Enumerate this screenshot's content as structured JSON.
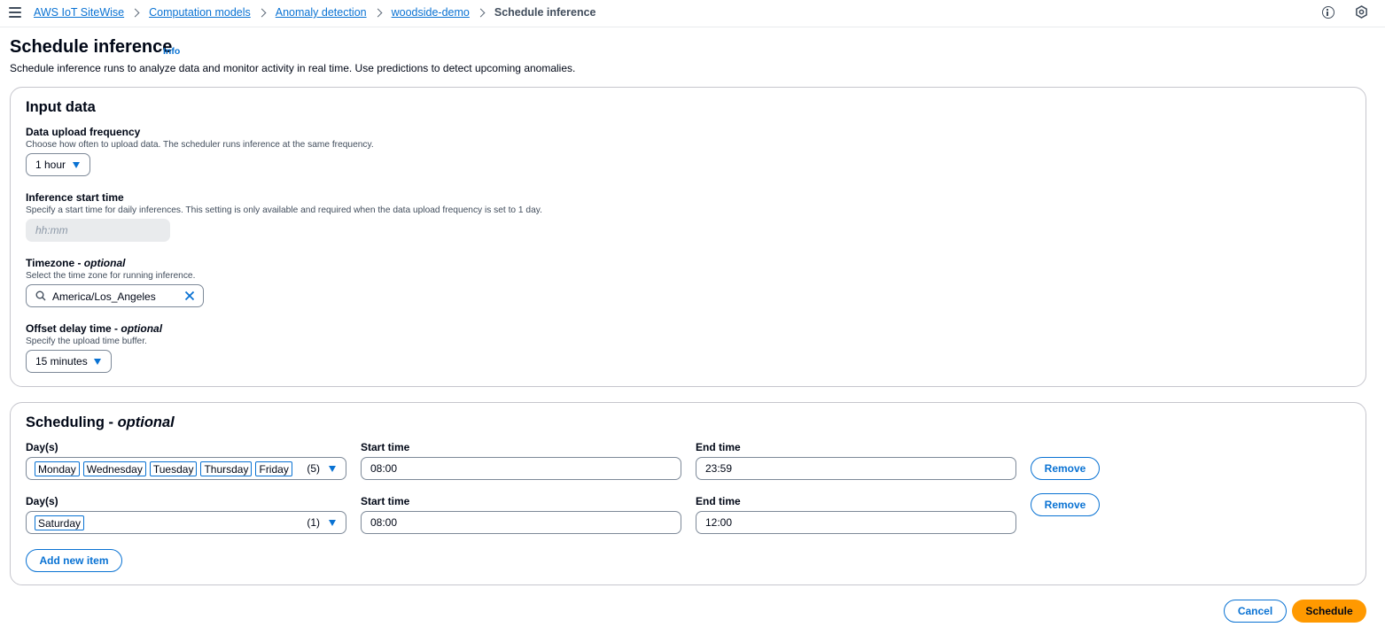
{
  "breadcrumbs": {
    "items": [
      "AWS IoT SiteWise",
      "Computation models",
      "Anomaly detection",
      "woodside-demo"
    ],
    "current": "Schedule inference"
  },
  "header": {
    "title": "Schedule inference",
    "info_link": "Info",
    "description": "Schedule inference runs to analyze data and monitor activity in real time. Use predictions to detect upcoming anomalies."
  },
  "input_data": {
    "title": "Input data",
    "upload_frequency": {
      "label": "Data upload frequency",
      "description": "Choose how often to upload data. The scheduler runs inference at the same frequency.",
      "value": "1 hour"
    },
    "start_time": {
      "label": "Inference start time",
      "description": "Specify a start time for daily inferences. This setting is only available and required when the data upload frequency is set to 1 day.",
      "placeholder": "hh:mm"
    },
    "timezone": {
      "label": "Timezone",
      "optional": "optional",
      "description": "Select the time zone for running inference.",
      "value": "America/Los_Angeles"
    },
    "offset_delay": {
      "label": "Offset delay time",
      "optional": "optional",
      "description": "Specify the upload time buffer.",
      "value": "15 minutes"
    }
  },
  "scheduling": {
    "title": "Scheduling",
    "optional": "optional",
    "days_label": "Day(s)",
    "start_label": "Start time",
    "end_label": "End time",
    "remove_label": "Remove",
    "add_label": "Add new item",
    "rows": [
      {
        "days": [
          "Monday",
          "Wednesday",
          "Tuesday",
          "Thursday",
          "Friday"
        ],
        "count": "(5)",
        "start": "08:00",
        "end": "23:59"
      },
      {
        "days": [
          "Saturday"
        ],
        "count": "(1)",
        "start": "08:00",
        "end": "12:00"
      }
    ]
  },
  "footer": {
    "cancel_label": "Cancel",
    "schedule_label": "Schedule"
  },
  "colors": {
    "link": "#0972d3",
    "primary": "#ff9900",
    "border": "#7d8998",
    "disabled": "#e9ebed"
  }
}
